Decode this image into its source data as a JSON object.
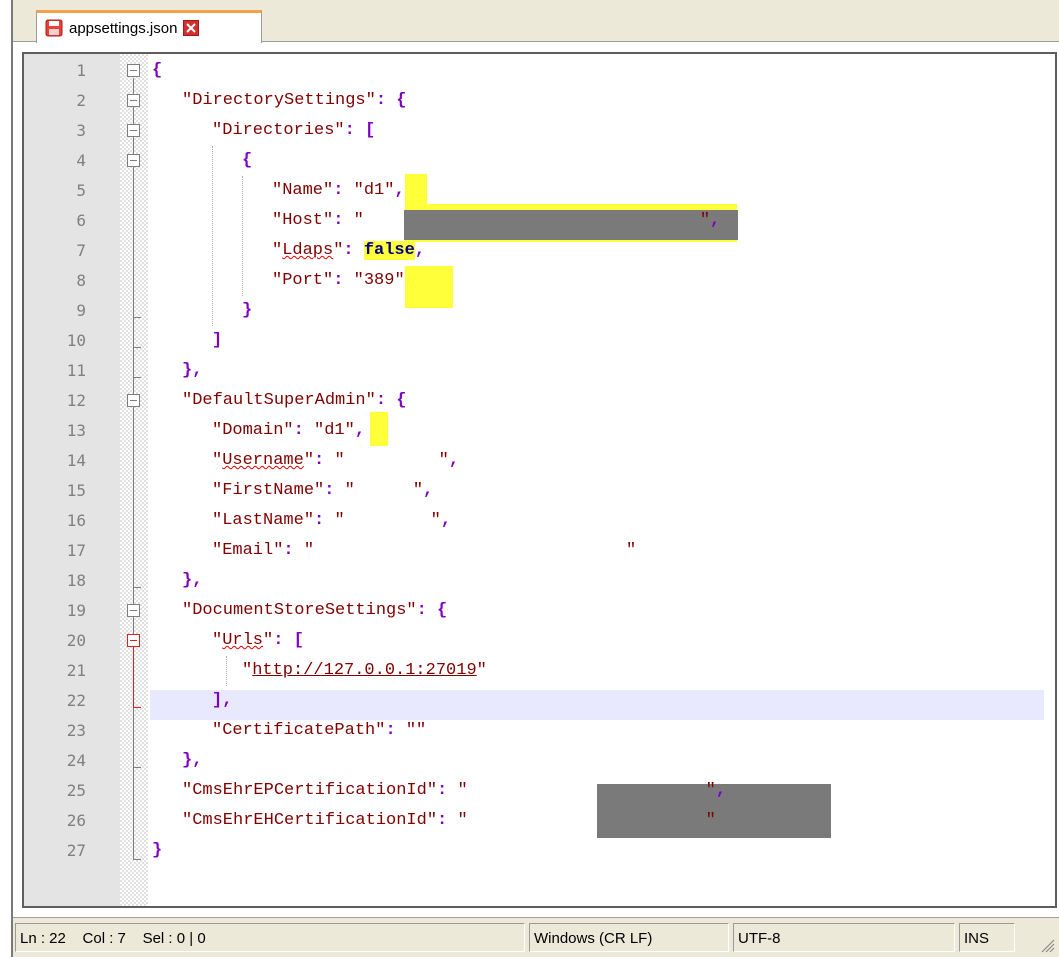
{
  "tab": {
    "title": "appsettings.json",
    "icon": "save-icon",
    "close_icon": "close-icon"
  },
  "editor": {
    "current_line": 22,
    "lines": [
      {
        "n": "1",
        "text": "{"
      },
      {
        "n": "2",
        "text": "\"DirectorySettings\": {"
      },
      {
        "n": "3",
        "text": "\"Directories\": ["
      },
      {
        "n": "4",
        "text": "{"
      },
      {
        "n": "5",
        "text": "\"Name\": \"d1\","
      },
      {
        "n": "6",
        "text": "\"Host\": \"\","
      },
      {
        "n": "7",
        "text": "\"Ldaps\": false,"
      },
      {
        "n": "8",
        "text": "\"Port\": \"389\""
      },
      {
        "n": "9",
        "text": "}"
      },
      {
        "n": "10",
        "text": "]"
      },
      {
        "n": "11",
        "text": "},"
      },
      {
        "n": "12",
        "text": "\"DefaultSuperAdmin\": {"
      },
      {
        "n": "13",
        "text": "\"Domain\": \"d1\","
      },
      {
        "n": "14",
        "text": "\"Username\": \"\","
      },
      {
        "n": "15",
        "text": "\"FirstName\": \"\","
      },
      {
        "n": "16",
        "text": "\"LastName\": \"\","
      },
      {
        "n": "17",
        "text": "\"Email\": \"\""
      },
      {
        "n": "18",
        "text": "},"
      },
      {
        "n": "19",
        "text": "\"DocumentStoreSettings\": {"
      },
      {
        "n": "20",
        "text": "\"Urls\": ["
      },
      {
        "n": "21",
        "text": "\"http://127.0.0.1:27019\""
      },
      {
        "n": "22",
        "text": "],"
      },
      {
        "n": "23",
        "text": "\"CertificatePath\": \"\""
      },
      {
        "n": "24",
        "text": "},"
      },
      {
        "n": "25",
        "text": "\"CmsEhrEPCertificationId\": \"\","
      },
      {
        "n": "26",
        "text": "\"CmsEhrEHCertificationId\": \"\""
      },
      {
        "n": "27",
        "text": "}"
      }
    ],
    "tokens": {
      "directory_settings_key": "\"DirectorySettings\"",
      "directories_key": "\"Directories\"",
      "name_key": "\"Name\"",
      "name_val": "d1",
      "host_key": "\"Host\"",
      "ldaps_key": "Ldaps",
      "ldaps_val": "false",
      "port_key": "\"Port\"",
      "port_val": "389",
      "default_super_admin_key": "\"DefaultSuperAdmin\"",
      "domain_key": "\"Domain\"",
      "domain_val": "d1",
      "username_key": "Username",
      "firstname_key": "\"FirstName\"",
      "lastname_key": "\"LastName\"",
      "email_key": "\"Email\"",
      "document_store_key": "\"DocumentStoreSettings\"",
      "urls_key": "Urls",
      "url_val": "http://127.0.0.1:27019",
      "cert_path_key": "\"CertificatePath\"",
      "ep_cert_key": "\"CmsEhrEPCertificationId\"",
      "eh_cert_key": "\"CmsEhrEHCertificationId\""
    }
  },
  "statusbar": {
    "ln": "Ln : 22",
    "col": "Col : 7",
    "sel": "Sel : 0 | 0",
    "eol": "Windows (CR LF)",
    "encoding": "UTF-8",
    "mode": "INS"
  },
  "colors": {
    "keyword": "#8000c0",
    "string": "#800000",
    "boolean": "#000080",
    "highlight": "#ffff3a",
    "current_line": "#e8e8ff",
    "redaction": "#7a7a7a",
    "tab_accent": "#f6a04a"
  }
}
